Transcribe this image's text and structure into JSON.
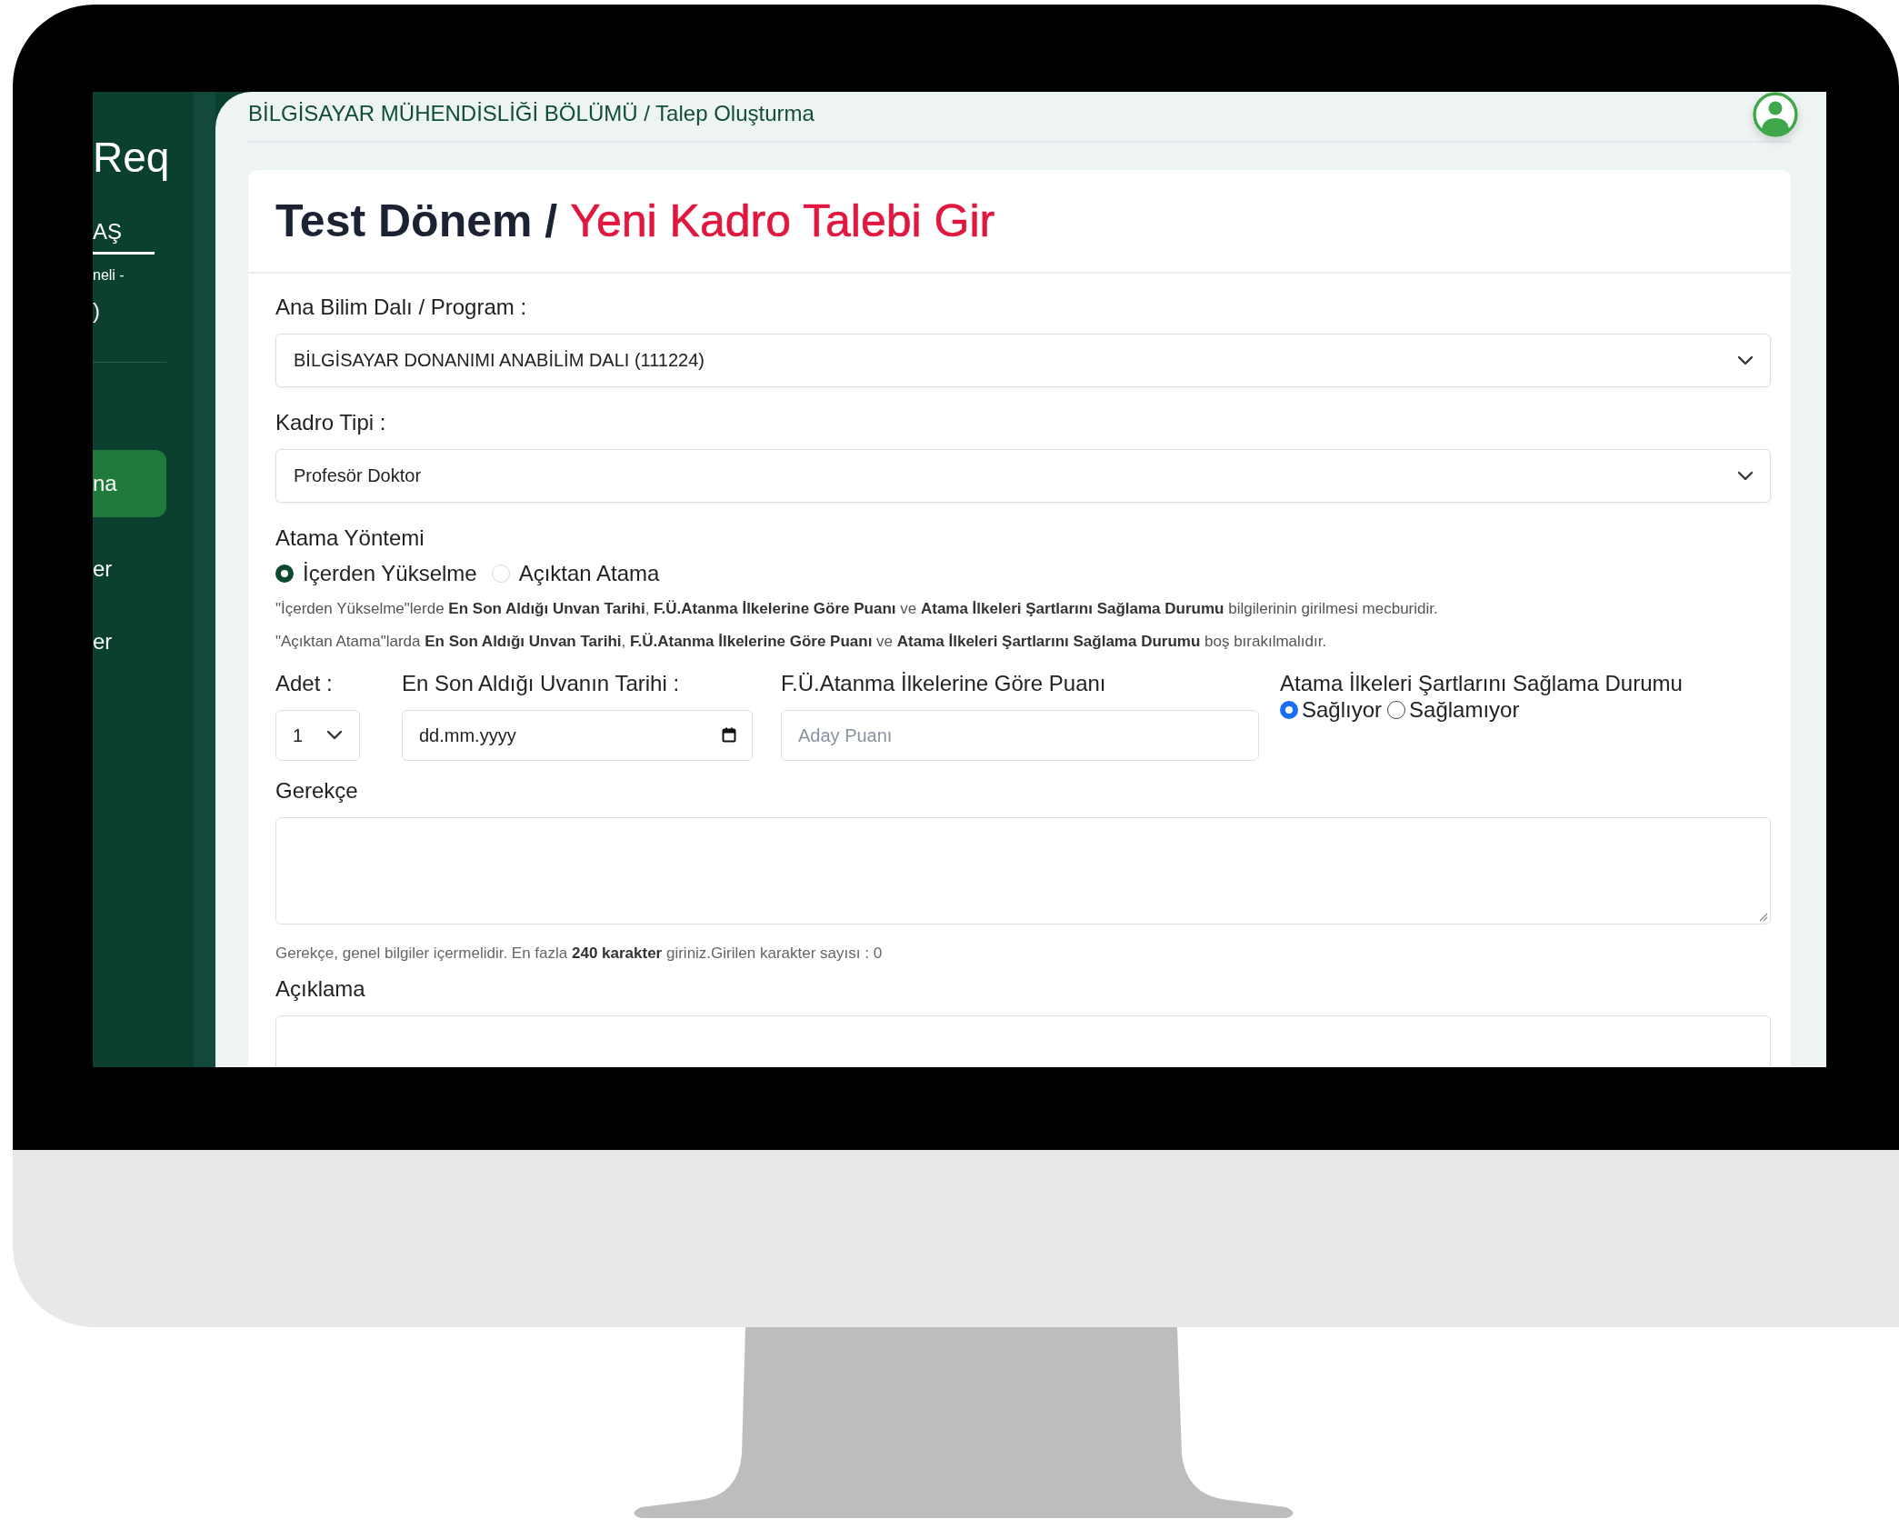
{
  "sidebar": {
    "brand": "Req",
    "user_name": "AŞ",
    "user_detail": "neli -",
    "user_extra": ")",
    "items": [
      {
        "label": "na",
        "selected": true
      },
      {
        "label": "er",
        "selected": false
      },
      {
        "label": "er",
        "selected": false
      }
    ]
  },
  "header": {
    "breadcrumb": "BİLGİSAYAR MÜHENDİSLİĞİ BÖLÜMÜ / Talep Oluşturma"
  },
  "card": {
    "title": "Test Dönem /",
    "subtitle": "Yeni Kadro Talebi Gir"
  },
  "form": {
    "program": {
      "label": "Ana Bilim Dalı / Program :",
      "value": "BİLGİSAYAR DONANIMI ANABİLİM DALI (111224)"
    },
    "kadro_tipi": {
      "label": "Kadro Tipi :",
      "value": "Profesör Doktor"
    },
    "atama_yontemi": {
      "label": "Atama Yöntemi",
      "options": [
        {
          "label": "İçerden Yükselme",
          "selected": true
        },
        {
          "label": "Açıktan Atama",
          "selected": false
        }
      ],
      "notes": [
        "\"İçerden Yükselme\"lerde **En Son Aldığı Unvan Tarihi**, **F.Ü.Atanma İlkelerine Göre Puanı** ve **Atama İlkeleri Şartlarını Sağlama Durumu** bilgilerinin girilmesi mecburidir.",
        "\"Açıktan Atama\"larda **En Son Aldığı Unvan Tarihi**, **F.Ü.Atanma İlkelerine Göre Puanı** ve **Atama İlkeleri Şartlarını Sağlama Durumu** boş bırakılmalıdır."
      ]
    },
    "adet": {
      "label": "Adet :",
      "value": "1"
    },
    "tarih": {
      "label": "En Son Aldığı Uvanın Tarihi :",
      "placeholder": "dd.mm.yyyy"
    },
    "puan": {
      "label": "F.Ü.Atanma İlkelerine Göre Puanı",
      "placeholder": "Aday Puanı"
    },
    "sartlar": {
      "label": "Atama İlkeleri Şartlarını Sağlama Durumu",
      "options": [
        {
          "label": "Sağlıyor",
          "selected": true
        },
        {
          "label": "Sağlamıyor",
          "selected": false
        }
      ]
    },
    "gerekce": {
      "label": "Gerekçe",
      "help": "Gerekçe, genel bilgiler içermelidir. En fazla **240 karakter** giriniz.Girilen karakter sayısı : 0"
    },
    "aciklama": {
      "label": "Açıklama"
    }
  }
}
